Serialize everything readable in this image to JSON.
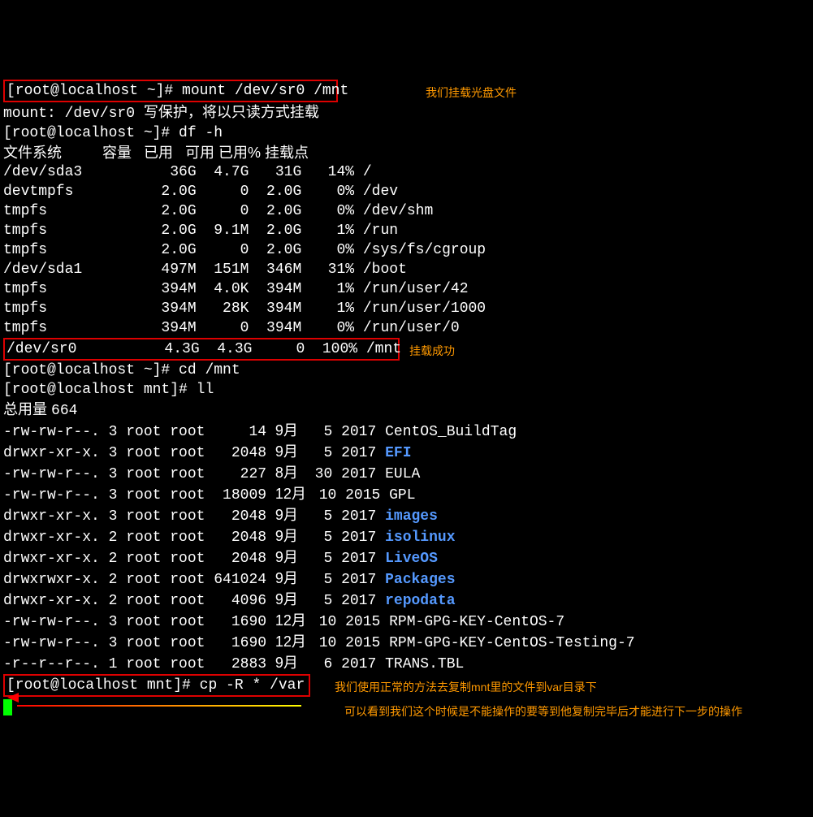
{
  "prompt_root_home": "[root@localhost ~]# ",
  "prompt_root_mnt": "[root@localhost mnt]# ",
  "cmd_mount": "mount /dev/sr0 /mnt",
  "mount_warn_pre": "mount: /dev/sr0 ",
  "mount_warn_cn": "写保护，将以只读方式挂载",
  "cmd_df": "df -h",
  "df_head_cn": {
    "fs": "文件系统",
    "size": "容量",
    "used": "已用",
    "avail": "可用",
    "usep": "已用%",
    "mount": "挂载点"
  },
  "df_rows": [
    {
      "fs": "/dev/sda3",
      "size": "36G",
      "used": "4.7G",
      "avail": "31G",
      "usep": "14%",
      "mount": "/"
    },
    {
      "fs": "devtmpfs",
      "size": "2.0G",
      "used": "0",
      "avail": "2.0G",
      "usep": "0%",
      "mount": "/dev"
    },
    {
      "fs": "tmpfs",
      "size": "2.0G",
      "used": "0",
      "avail": "2.0G",
      "usep": "0%",
      "mount": "/dev/shm"
    },
    {
      "fs": "tmpfs",
      "size": "2.0G",
      "used": "9.1M",
      "avail": "2.0G",
      "usep": "1%",
      "mount": "/run"
    },
    {
      "fs": "tmpfs",
      "size": "2.0G",
      "used": "0",
      "avail": "2.0G",
      "usep": "0%",
      "mount": "/sys/fs/cgroup"
    },
    {
      "fs": "/dev/sda1",
      "size": "497M",
      "used": "151M",
      "avail": "346M",
      "usep": "31%",
      "mount": "/boot"
    },
    {
      "fs": "tmpfs",
      "size": "394M",
      "used": "4.0K",
      "avail": "394M",
      "usep": "1%",
      "mount": "/run/user/42"
    },
    {
      "fs": "tmpfs",
      "size": "394M",
      "used": "28K",
      "avail": "394M",
      "usep": "1%",
      "mount": "/run/user/1000"
    },
    {
      "fs": "tmpfs",
      "size": "394M",
      "used": "0",
      "avail": "394M",
      "usep": "0%",
      "mount": "/run/user/0"
    }
  ],
  "df_sr0": {
    "fs": "/dev/sr0",
    "size": "4.3G",
    "used": "4.3G",
    "avail": "0",
    "usep": "100%",
    "mount": "/mnt"
  },
  "cmd_cd": "cd /mnt",
  "cmd_ll": "ll",
  "total_cn_pre": "总用量 ",
  "total_val": "664",
  "ll_rows": [
    {
      "perm": "-rw-rw-r--.",
      "n": "3",
      "o": "root",
      "g": "root",
      "sz": "14",
      "mo": "9月",
      "d": "5",
      "y": "2017",
      "name": "CentOS_BuildTag",
      "dir": false
    },
    {
      "perm": "drwxr-xr-x.",
      "n": "3",
      "o": "root",
      "g": "root",
      "sz": "2048",
      "mo": "9月",
      "d": "5",
      "y": "2017",
      "name": "EFI",
      "dir": true
    },
    {
      "perm": "-rw-rw-r--.",
      "n": "3",
      "o": "root",
      "g": "root",
      "sz": "227",
      "mo": "8月",
      "d": "30",
      "y": "2017",
      "name": "EULA",
      "dir": false
    },
    {
      "perm": "-rw-rw-r--.",
      "n": "3",
      "o": "root",
      "g": "root",
      "sz": "18009",
      "mo": "12月",
      "d": "10",
      "y": "2015",
      "name": "GPL",
      "dir": false
    },
    {
      "perm": "drwxr-xr-x.",
      "n": "3",
      "o": "root",
      "g": "root",
      "sz": "2048",
      "mo": "9月",
      "d": "5",
      "y": "2017",
      "name": "images",
      "dir": true
    },
    {
      "perm": "drwxr-xr-x.",
      "n": "2",
      "o": "root",
      "g": "root",
      "sz": "2048",
      "mo": "9月",
      "d": "5",
      "y": "2017",
      "name": "isolinux",
      "dir": true
    },
    {
      "perm": "drwxr-xr-x.",
      "n": "2",
      "o": "root",
      "g": "root",
      "sz": "2048",
      "mo": "9月",
      "d": "5",
      "y": "2017",
      "name": "LiveOS",
      "dir": true
    },
    {
      "perm": "drwxrwxr-x.",
      "n": "2",
      "o": "root",
      "g": "root",
      "sz": "641024",
      "mo": "9月",
      "d": "5",
      "y": "2017",
      "name": "Packages",
      "dir": true
    },
    {
      "perm": "drwxr-xr-x.",
      "n": "2",
      "o": "root",
      "g": "root",
      "sz": "4096",
      "mo": "9月",
      "d": "5",
      "y": "2017",
      "name": "repodata",
      "dir": true
    },
    {
      "perm": "-rw-rw-r--.",
      "n": "3",
      "o": "root",
      "g": "root",
      "sz": "1690",
      "mo": "12月",
      "d": "10",
      "y": "2015",
      "name": "RPM-GPG-KEY-CentOS-7",
      "dir": false
    },
    {
      "perm": "-rw-rw-r--.",
      "n": "3",
      "o": "root",
      "g": "root",
      "sz": "1690",
      "mo": "12月",
      "d": "10",
      "y": "2015",
      "name": "RPM-GPG-KEY-CentOS-Testing-7",
      "dir": false
    },
    {
      "perm": "-r--r--r--.",
      "n": "1",
      "o": "root",
      "g": "root",
      "sz": "2883",
      "mo": "9月",
      "d": "6",
      "y": "2017",
      "name": "TRANS.TBL",
      "dir": false
    }
  ],
  "cmd_cp": "cp -R * /var",
  "ann": {
    "a1": "我们挂载光盘文件",
    "a2": "挂载成功",
    "a3": "我们使用正常的方法去复制mnt里的文件到var目录下",
    "a4": "可以看到我们这个时候是不能操作的要等到他复制完毕后才能进行下一步的操作"
  }
}
